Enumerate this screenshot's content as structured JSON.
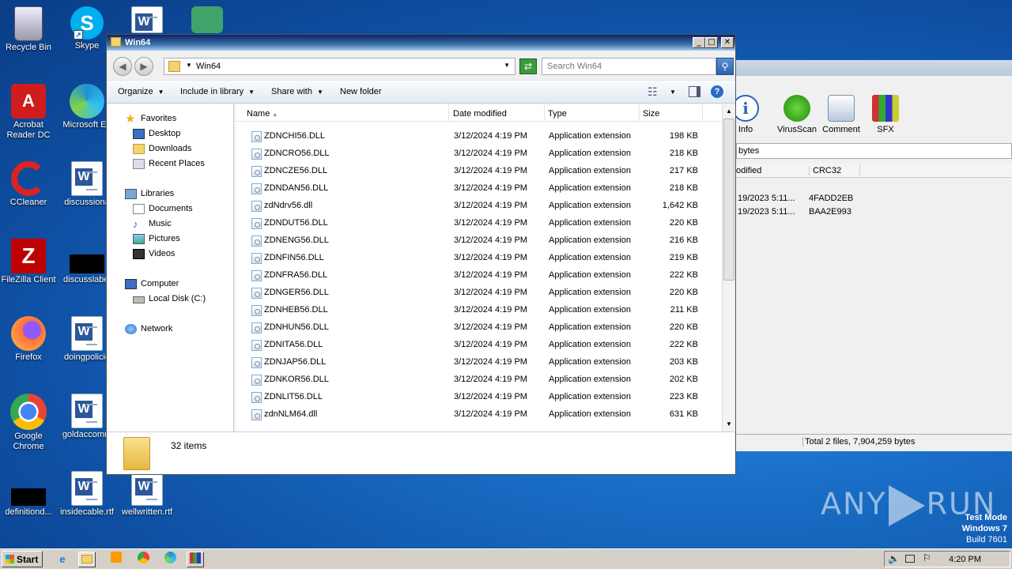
{
  "desktop": {
    "icons": [
      {
        "label": "Recycle Bin"
      },
      {
        "label": "Skype"
      },
      {
        "label": "Acrobat Reader DC"
      },
      {
        "label": "Microsoft Ed"
      },
      {
        "label": "CCleaner"
      },
      {
        "label": "discussiona"
      },
      {
        "label": "FileZilla Client"
      },
      {
        "label": "discusslabel"
      },
      {
        "label": "Firefox"
      },
      {
        "label": "doingpolicie"
      },
      {
        "label": "Google Chrome"
      },
      {
        "label": "goldaccomm"
      },
      {
        "label": "definitiond..."
      },
      {
        "label": "insidecable.rtf"
      },
      {
        "label": "wellwritten.rtf"
      }
    ]
  },
  "rar": {
    "toolbar": [
      {
        "label": "Info",
        "icon": "info-icon"
      },
      {
        "label": "VirusScan",
        "icon": "virus-scan-icon"
      },
      {
        "label": "Comment",
        "icon": "comment-icon"
      },
      {
        "label": "SFX",
        "icon": "sfx-icon"
      }
    ],
    "path_text": "bytes",
    "columns": [
      "odified",
      "CRC32"
    ],
    "rows": [
      {
        "modified": "19/2023 5:11...",
        "crc": "4FADD2EB"
      },
      {
        "modified": "19/2023 5:11...",
        "crc": "BAA2E993"
      }
    ],
    "status": "Total 2 files, 7,904,259 bytes"
  },
  "explorer": {
    "title": "Win64",
    "window_buttons": {
      "minimize": "_",
      "maximize": "□",
      "close": "✕"
    },
    "address": {
      "path": "Win64"
    },
    "search": {
      "placeholder": "Search Win64"
    },
    "commands": {
      "organize": "Organize",
      "include": "Include in library",
      "share": "Share with",
      "new_folder": "New folder"
    },
    "nav": {
      "favorites": "Favorites",
      "desktop": "Desktop",
      "downloads": "Downloads",
      "recent": "Recent Places",
      "libraries": "Libraries",
      "documents": "Documents",
      "music": "Music",
      "pictures": "Pictures",
      "videos": "Videos",
      "computer": "Computer",
      "local_disk": "Local Disk (C:)",
      "network": "Network"
    },
    "columns": {
      "name": "Name",
      "date": "Date modified",
      "type": "Type",
      "size": "Size"
    },
    "files": [
      {
        "name": "ZDNCHI56.DLL",
        "date": "3/12/2024 4:19 PM",
        "type": "Application extension",
        "size": "198 KB"
      },
      {
        "name": "ZDNCRO56.DLL",
        "date": "3/12/2024 4:19 PM",
        "type": "Application extension",
        "size": "218 KB"
      },
      {
        "name": "ZDNCZE56.DLL",
        "date": "3/12/2024 4:19 PM",
        "type": "Application extension",
        "size": "217 KB"
      },
      {
        "name": "ZDNDAN56.DLL",
        "date": "3/12/2024 4:19 PM",
        "type": "Application extension",
        "size": "218 KB"
      },
      {
        "name": "zdNdrv56.dll",
        "date": "3/12/2024 4:19 PM",
        "type": "Application extension",
        "size": "1,642 KB"
      },
      {
        "name": "ZDNDUT56.DLL",
        "date": "3/12/2024 4:19 PM",
        "type": "Application extension",
        "size": "220 KB"
      },
      {
        "name": "ZDNENG56.DLL",
        "date": "3/12/2024 4:19 PM",
        "type": "Application extension",
        "size": "216 KB"
      },
      {
        "name": "ZDNFIN56.DLL",
        "date": "3/12/2024 4:19 PM",
        "type": "Application extension",
        "size": "219 KB"
      },
      {
        "name": "ZDNFRA56.DLL",
        "date": "3/12/2024 4:19 PM",
        "type": "Application extension",
        "size": "222 KB"
      },
      {
        "name": "ZDNGER56.DLL",
        "date": "3/12/2024 4:19 PM",
        "type": "Application extension",
        "size": "220 KB"
      },
      {
        "name": "ZDNHEB56.DLL",
        "date": "3/12/2024 4:19 PM",
        "type": "Application extension",
        "size": "211 KB"
      },
      {
        "name": "ZDNHUN56.DLL",
        "date": "3/12/2024 4:19 PM",
        "type": "Application extension",
        "size": "220 KB"
      },
      {
        "name": "ZDNITA56.DLL",
        "date": "3/12/2024 4:19 PM",
        "type": "Application extension",
        "size": "222 KB"
      },
      {
        "name": "ZDNJAP56.DLL",
        "date": "3/12/2024 4:19 PM",
        "type": "Application extension",
        "size": "203 KB"
      },
      {
        "name": "ZDNKOR56.DLL",
        "date": "3/12/2024 4:19 PM",
        "type": "Application extension",
        "size": "202 KB"
      },
      {
        "name": "ZDNLIT56.DLL",
        "date": "3/12/2024 4:19 PM",
        "type": "Application extension",
        "size": "223 KB"
      },
      {
        "name": "zdnNLM64.dll",
        "date": "3/12/2024 4:19 PM",
        "type": "Application extension",
        "size": "631 KB"
      }
    ],
    "item_count": "32 items"
  },
  "watermark": {
    "left": "ANY",
    "right": "RUN"
  },
  "testmode": {
    "line1": "Test Mode",
    "line2": "Windows 7",
    "line3": "Build 7601"
  },
  "taskbar": {
    "start": "Start",
    "clock": "4:20 PM"
  },
  "colors": {
    "desktop": "#1a6fc8",
    "titlebar": "#0a246a",
    "taskbar": "#d4d0c8"
  }
}
